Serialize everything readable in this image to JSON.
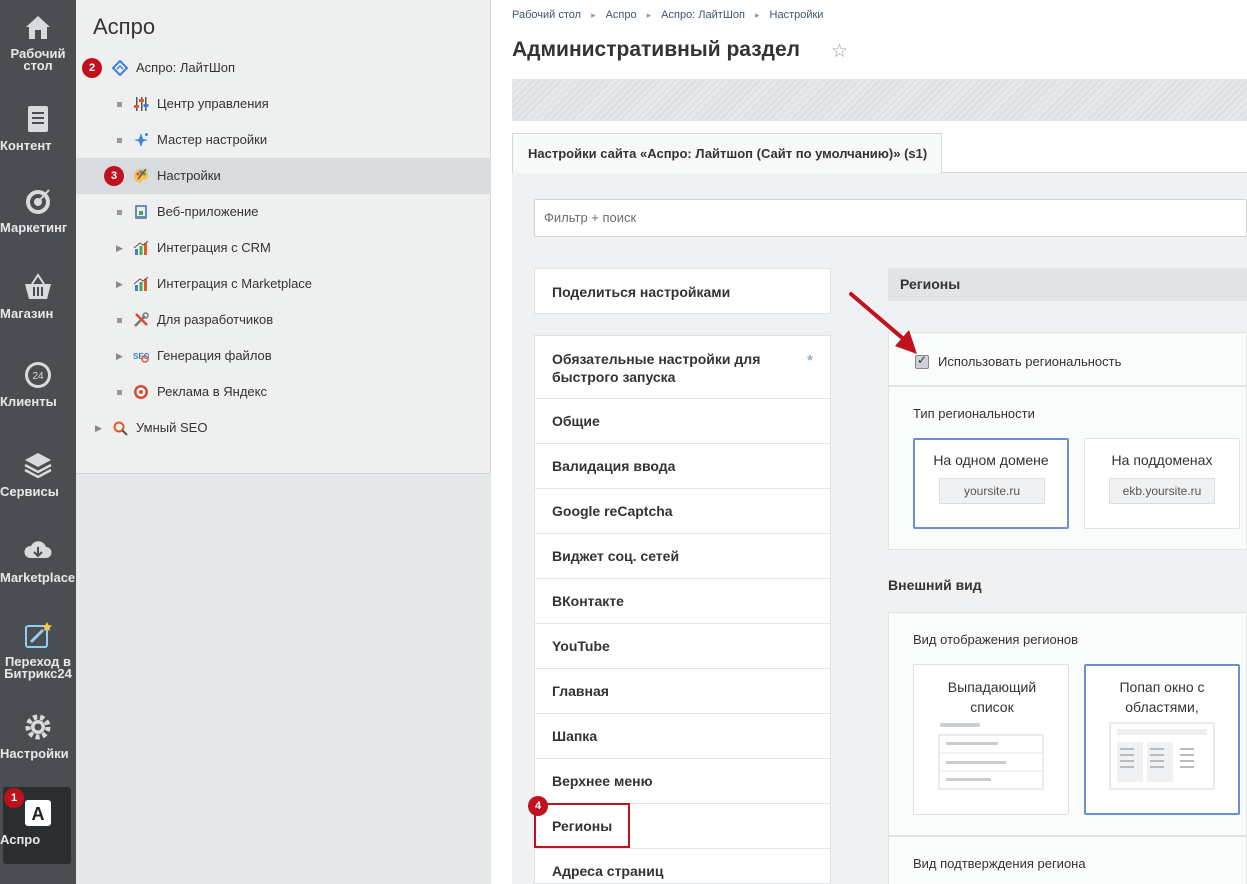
{
  "rail": {
    "items": [
      {
        "label": "Рабочий стол",
        "icon": "home-icon"
      },
      {
        "label": "Контент",
        "icon": "document-icon"
      },
      {
        "label": "Маркетинг",
        "icon": "target-icon"
      },
      {
        "label": "Магазин",
        "icon": "basket-icon"
      },
      {
        "label": "Клиенты",
        "icon": "clock24-icon"
      },
      {
        "label": "Сервисы",
        "icon": "layers-icon"
      },
      {
        "label": "Marketplace",
        "icon": "cloud-download-icon"
      },
      {
        "label": "Переход в Битрикс24",
        "icon": "magic-pencil-icon"
      },
      {
        "label": "Настройки",
        "icon": "gear-icon"
      },
      {
        "label": "Аспро",
        "icon": "aspro-a-icon"
      }
    ]
  },
  "menu": {
    "title": "Аспро",
    "items": [
      {
        "label": "Аспро: ЛайтШоп"
      },
      {
        "label": "Центр управления"
      },
      {
        "label": "Мастер настройки"
      },
      {
        "label": "Настройки"
      },
      {
        "label": "Веб-приложение"
      },
      {
        "label": "Интеграция с CRM"
      },
      {
        "label": "Интеграция с Marketplace"
      },
      {
        "label": "Для разработчиков"
      },
      {
        "label": "Генерация файлов"
      },
      {
        "label": "Реклама в Яндекс"
      },
      {
        "label": "Умный SEO"
      }
    ]
  },
  "badges": {
    "b1": "1",
    "b2": "2",
    "b3": "3",
    "b4": "4"
  },
  "breadcrumb": [
    "Рабочий стол",
    "Аспро",
    "Аспро: ЛайтШоп",
    "Настройки"
  ],
  "page_title": "Административный раздел",
  "tab_label": "Настройки сайта «Аспро: Лайтшоп (Сайт по умолчанию)» (s1)",
  "filter_placeholder": "Фильтр + поиск",
  "share_label": "Поделиться настройками",
  "settings_items": [
    "Обязательные настройки для быстрого запуска",
    "Общие",
    "Валидация ввода",
    "Google reCaptcha",
    "Виджет соц. сетей",
    "ВКонтакте",
    "YouTube",
    "Главная",
    "Шапка",
    "Верхнее меню",
    "Регионы",
    "Адреса страниц"
  ],
  "asterisk": "*",
  "regions": {
    "section_title": "Регионы",
    "use_regional_label": "Использовать региональность",
    "use_regional_checked": true,
    "type_label": "Тип региональности",
    "type_options": [
      {
        "title": "На одном домене",
        "example": "yoursite.ru",
        "selected": true
      },
      {
        "title": "На поддоменах",
        "example": "ekb.yoursite.ru",
        "selected": false
      }
    ]
  },
  "appearance": {
    "title": "Внешний вид",
    "display_label": "Вид отображения регионов",
    "display_options": [
      {
        "title": "Выпадающий список",
        "selected": false
      },
      {
        "title": "Попап окно с областями, округами",
        "selected": true
      }
    ],
    "confirm_label": "Вид подтверждения региона"
  },
  "colors": {
    "accent_red": "#c0121e",
    "select_blue": "#6b8fd1",
    "rail_bg": "#4a4e53"
  }
}
